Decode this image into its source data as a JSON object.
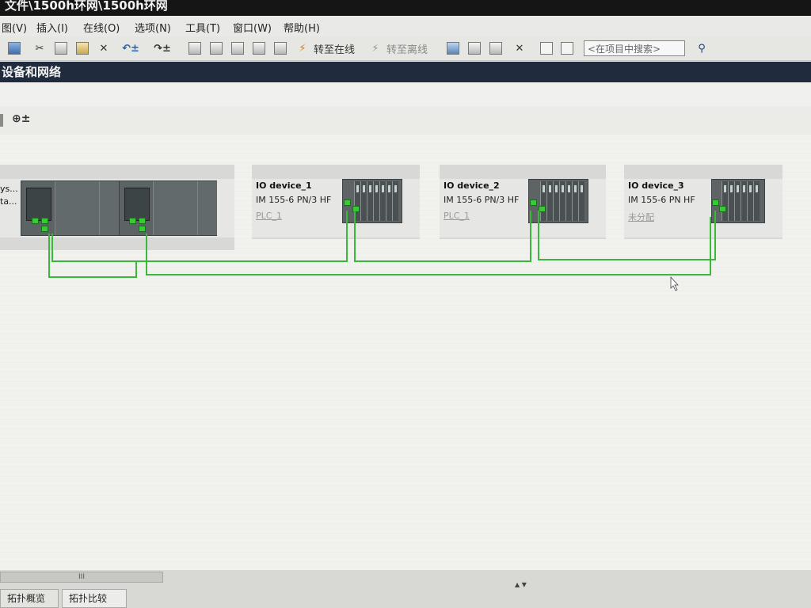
{
  "title": "文件\\1500h环网\\1500h环网",
  "menu": [
    "图(V)",
    "插入(I)",
    "在线(O)",
    "选项(N)",
    "工具(T)",
    "窗口(W)",
    "帮助(H)"
  ],
  "toolbar": {
    "go_online": "转至在线",
    "go_offline": "转至离线",
    "search_placeholder": "<在项目中搜索>"
  },
  "section_title": "设备和网络",
  "plc": {
    "name_partial": "ys...",
    "sub_partial": "ta..."
  },
  "devices": [
    {
      "name": "IO device_1",
      "type": "IM 155-6 PN/3 HF",
      "assigned": "PLC_1"
    },
    {
      "name": "IO device_2",
      "type": "IM 155-6 PN/3 HF",
      "assigned": "PLC_1"
    },
    {
      "name": "IO device_3",
      "type": "IM 155-6 PN HF",
      "assigned": "未分配"
    }
  ],
  "scrollbar_label": "III",
  "bottom_tabs": [
    "拓扑概览",
    "拓扑比较"
  ],
  "colors": {
    "network_line": "#3ab83a",
    "section_bar": "#212b3e"
  }
}
